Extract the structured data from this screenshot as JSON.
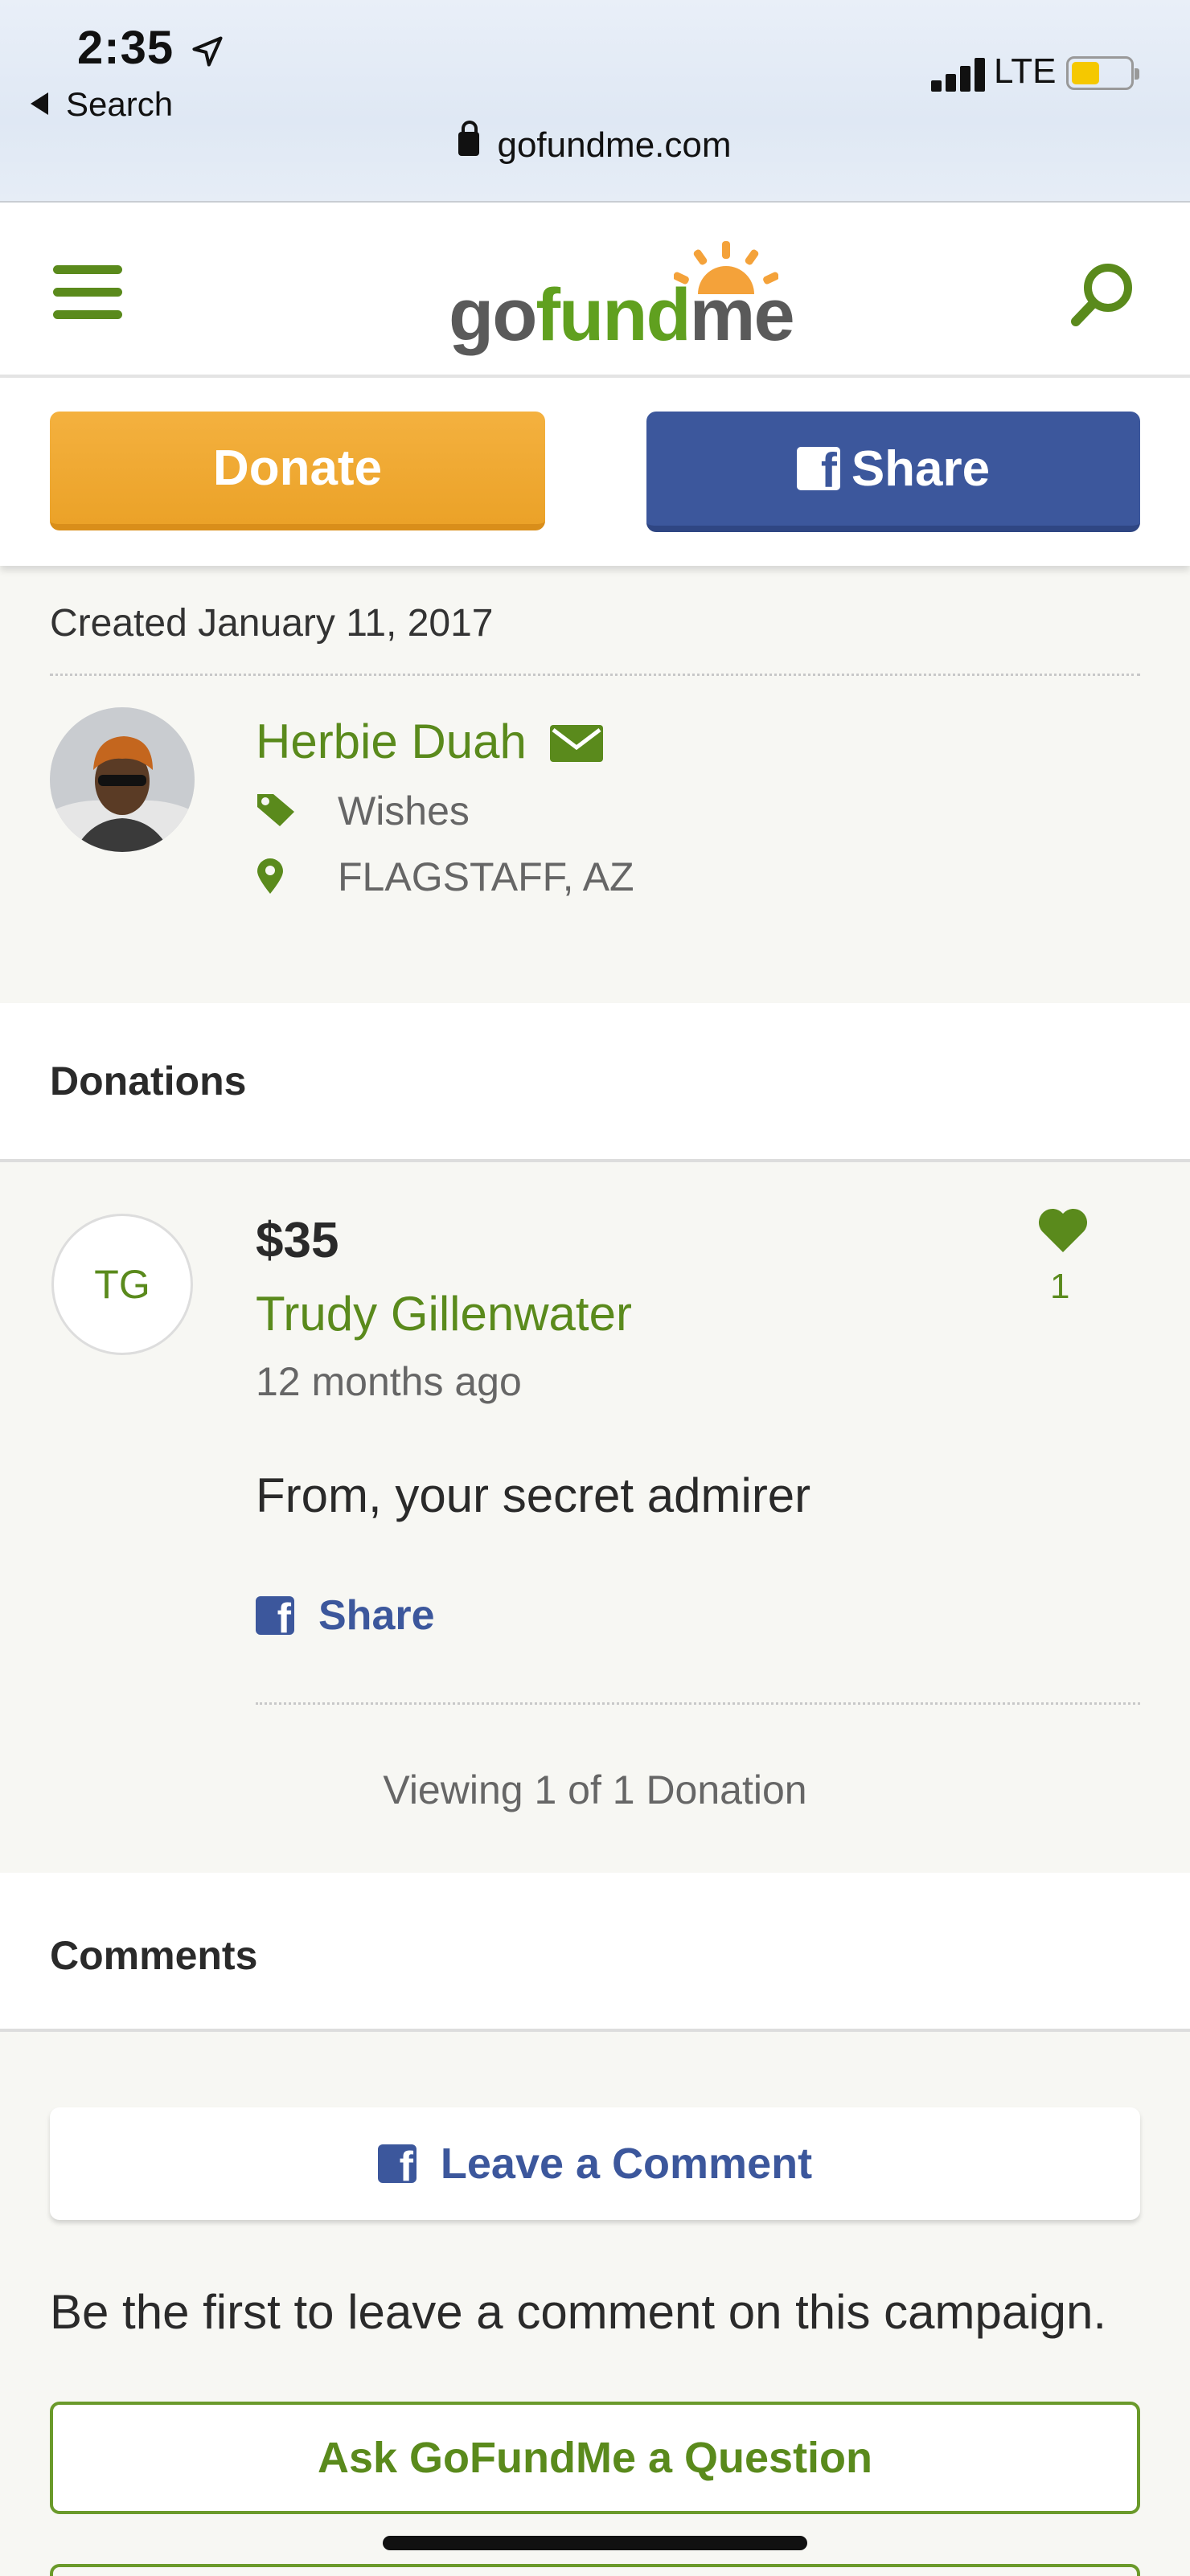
{
  "status_bar": {
    "time": "2:35",
    "back_label": "Search",
    "network": "LTE",
    "url": "gofundme.com"
  },
  "header": {
    "logo_go": "go",
    "logo_fund": "fund",
    "logo_me": "me"
  },
  "actions": {
    "donate_label": "Donate",
    "share_label": "Share"
  },
  "campaign": {
    "created": "Created January 11, 2017",
    "organizer_name": "Herbie Duah",
    "category": "Wishes",
    "location": "FLAGSTAFF, AZ"
  },
  "donations": {
    "section_title": "Donations",
    "items": [
      {
        "initials": "TG",
        "amount": "$35",
        "donor": "Trudy Gillenwater",
        "time_ago": "12 months ago",
        "message": "From, your secret admirer",
        "likes": "1",
        "share_label": "Share"
      }
    ],
    "viewing": "Viewing 1 of 1 Donation"
  },
  "comments": {
    "section_title": "Comments",
    "leave_comment_label": "Leave a Comment",
    "empty_text": "Be the first to leave a comment on this campaign.",
    "ask_label": "Ask GoFundMe a Question"
  },
  "colors": {
    "brand_green": "#5a8a1c",
    "donate_orange": "#eba228",
    "facebook_blue": "#3c579c"
  }
}
